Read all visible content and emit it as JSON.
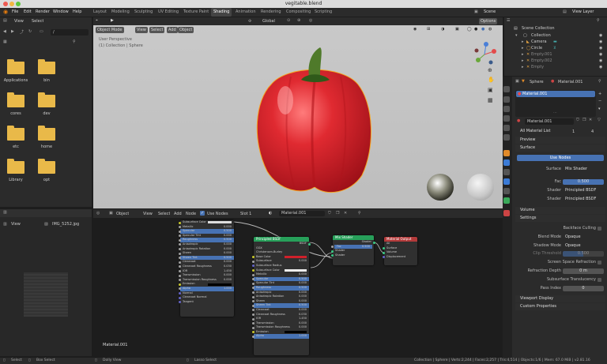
{
  "window": {
    "title": "vegitable.blend"
  },
  "menu": {
    "file": "File",
    "edit": "Edit",
    "render": "Render",
    "window": "Window",
    "help": "Help"
  },
  "workspaces": [
    "Layout",
    "Modeling",
    "Sculpting",
    "UV Editing",
    "Texture Paint",
    "Shading",
    "Animation",
    "Rendering",
    "Compositing",
    "Scripting"
  ],
  "scene": {
    "label": "Scene",
    "view_layer": "View Layer"
  },
  "file_browser": {
    "view": "View",
    "select": "Select",
    "path": "/",
    "folders": [
      "Applications",
      "bin",
      "cores",
      "dev",
      "etc",
      "home",
      "Library",
      "opt"
    ]
  },
  "image_editor": {
    "view": "View",
    "image_name": "IMG_5252.jpg"
  },
  "viewport": {
    "mode": "Object Mode",
    "view": "View",
    "select": "Select",
    "add": "Add",
    "object": "Object",
    "info1": "User Perspective",
    "info2": "(1) Collection | Sphere",
    "orientation": "Global",
    "options": "Options"
  },
  "node_editor": {
    "object": "Object",
    "view": "View",
    "select": "Select",
    "add": "Add",
    "node": "Node",
    "use_nodes": "Use Nodes",
    "slot": "Slot 1",
    "material": "Material.001",
    "label": "Material.001"
  },
  "node_left": {
    "rows": [
      [
        "Subsurface Color",
        ""
      ],
      [
        "Metallic",
        "0.000"
      ],
      [
        "Specular",
        "0.500"
      ],
      [
        "Specular Tint",
        "0.000"
      ],
      [
        "Roughness",
        "0.500"
      ],
      [
        "Anisotropic",
        "0.000"
      ],
      [
        "Anisotropic Rotation",
        "0.000"
      ],
      [
        "Sheen",
        "0.000"
      ],
      [
        "Sheen Tint",
        "0.500"
      ],
      [
        "Clearcoat",
        "0.000"
      ],
      [
        "Clearcoat Roughness",
        "0.030"
      ],
      [
        "IOR",
        "1.450"
      ],
      [
        "Transmission",
        "0.000"
      ],
      [
        "Transmission Roughness",
        "0.000"
      ],
      [
        "Emission",
        ""
      ],
      [
        "Alpha",
        "1.000"
      ],
      [
        "Normal",
        ""
      ],
      [
        "Clearcoat Normal",
        ""
      ],
      [
        "Tangent",
        ""
      ]
    ]
  },
  "node_bsdf": {
    "title": "Principled BSDF",
    "out": "BSDF",
    "dist": "GGX",
    "sss": "Christensen-Burley",
    "rows": [
      [
        "Base Color",
        ""
      ],
      [
        "Subsurface",
        "0.000"
      ],
      [
        "Subsurface Radius",
        ""
      ],
      [
        "Subsurface Color",
        ""
      ],
      [
        "Metallic",
        "0.000"
      ],
      [
        "Specular",
        "0.500"
      ],
      [
        "Specular Tint",
        "0.000"
      ],
      [
        "Roughness",
        "0.500"
      ],
      [
        "Anisotropic",
        "0.000"
      ],
      [
        "Anisotropic Rotation",
        "0.000"
      ],
      [
        "Sheen",
        "0.000"
      ],
      [
        "Sheen Tint",
        "0.500"
      ],
      [
        "Clearcoat",
        "0.000"
      ],
      [
        "Clearcoat Roughness",
        "0.030"
      ],
      [
        "IOR",
        "1.450"
      ],
      [
        "Transmission",
        "0.000"
      ],
      [
        "Transmission Roughness",
        "0.000"
      ],
      [
        "Emission",
        ""
      ],
      [
        "Alpha",
        "1.000"
      ]
    ]
  },
  "node_mix": {
    "title": "Mix Shader",
    "out": "Shader",
    "fac": "Fac",
    "fac_val": "0.500",
    "shader1": "Shader",
    "shader2": "Shader"
  },
  "node_output": {
    "title": "Material Output",
    "target": "All",
    "surface": "Surface",
    "volume": "Volume",
    "displacement": "Displacement"
  },
  "outliner": {
    "title": "Scene Collection",
    "items": [
      "Collection",
      "Camera",
      "Circle",
      "Empty.001",
      "Empty.002",
      "Empty"
    ]
  },
  "properties": {
    "object": "Sphere",
    "material": "Material.001",
    "slot_item": "Material.001",
    "mat_field": "Material.001",
    "all_material_list": "All Material List",
    "preview": "Preview",
    "surface": "Surface",
    "use_nodes": "Use Nodes",
    "surface_label": "Surface",
    "surface_value": "Mix Shader",
    "fac_label": "Fac",
    "fac_value": "0.500",
    "shader_label": "Shader",
    "shader1": "Principled BSDF",
    "shader2": "Principled BSDF",
    "volume": "Volume",
    "settings": "Settings",
    "backface": "Backface Culling",
    "blend_label": "Blend Mode",
    "blend_value": "Opaque",
    "shadow_label": "Shadow Mode",
    "shadow_value": "Opaque",
    "clip_label": "Clip Threshold",
    "clip_value": "0.500",
    "ssr": "Screen Space Refraction",
    "refr_label": "Refraction Depth",
    "refr_value": "0 m",
    "sst": "Subsurface Translucency",
    "pass_label": "Pass Index",
    "pass_value": "0",
    "viewport_display": "Viewport Display",
    "custom_props": "Custom Properties",
    "n1": "1",
    "n4": "4"
  },
  "status": {
    "select": "Select",
    "box_select": "Box Select",
    "dolly": "Dolly View",
    "lasso": "Lasso Select",
    "stats": "Collection | Sphere | Verts:2,244 | Faces:2,257 | Tris:4,514 | Objects:1/6 | Mem: 67.0 MiB | v2.81.16"
  },
  "colors": {
    "accent": "#4772b3",
    "bsdf_header": "#27a05a",
    "mix_header": "#27a05a",
    "output_header": "#b33a3a",
    "pepper": "#d0202a"
  }
}
